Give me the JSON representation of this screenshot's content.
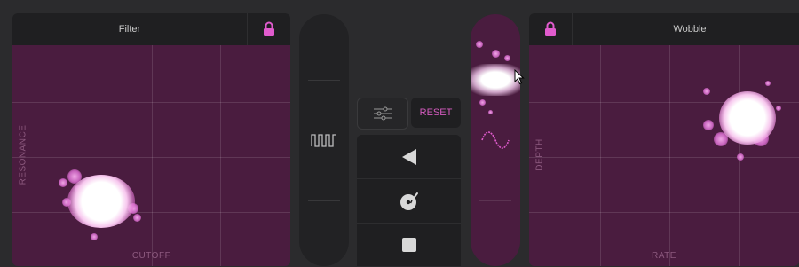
{
  "filter": {
    "title": "Filter",
    "x_label": "CUTOFF",
    "y_label": "RESONANCE"
  },
  "wobble": {
    "title": "Wobble",
    "x_label": "RATE",
    "y_label": "DEPTH"
  },
  "center": {
    "reset_label": "RESET"
  },
  "icons": {
    "filter_lock": "lock-icon",
    "wobble_lock": "lock-icon",
    "square_wave": "square-wave-icon",
    "sine_wave": "sine-wave-icon",
    "settings": "sliders-icon",
    "reverse": "play-reverse-icon",
    "turntable": "turntable-icon",
    "stop": "stop-icon"
  },
  "colors": {
    "accent": "#e05bcd",
    "pad_bg": "#4a1c3f",
    "panel_bg": "#1f1f21"
  }
}
